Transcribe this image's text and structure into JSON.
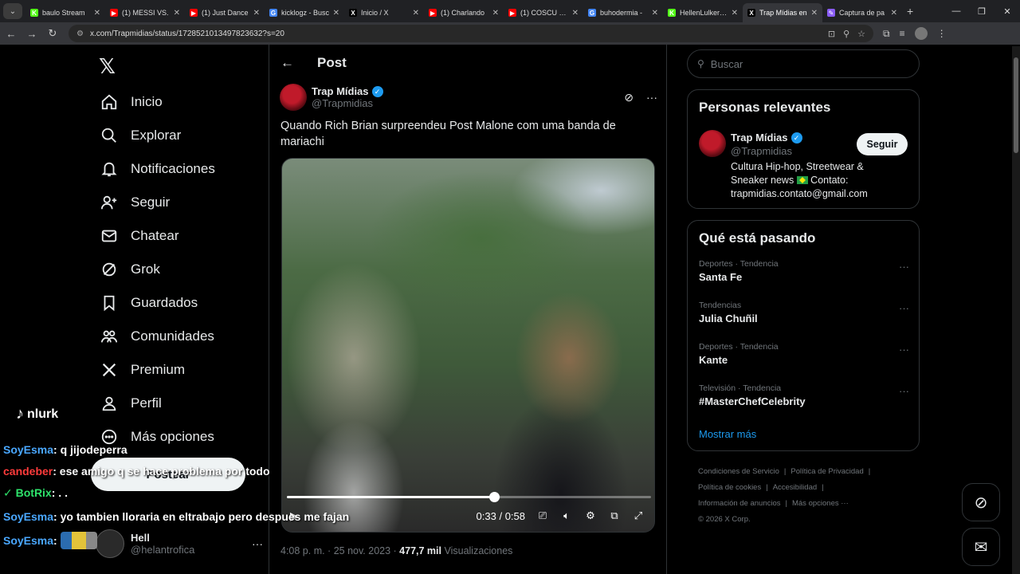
{
  "browser": {
    "tabs": [
      {
        "title": "baulo Stream",
        "color": "#53fc18",
        "glyph": "K"
      },
      {
        "title": "(1) MESSI VS.",
        "color": "#ff0000",
        "glyph": "▶"
      },
      {
        "title": "(1) Just Dance",
        "color": "#ff0000",
        "glyph": "▶"
      },
      {
        "title": "kicklogz - Busc",
        "color": "#4285f4",
        "glyph": "G"
      },
      {
        "title": "Inicio / X",
        "color": "#000000",
        "glyph": "X"
      },
      {
        "title": "(1) Charlando",
        "color": "#ff0000",
        "glyph": "▶"
      },
      {
        "title": "(1) COSCU DES",
        "color": "#ff0000",
        "glyph": "▶"
      },
      {
        "title": "buhodermia -",
        "color": "#4285f4",
        "glyph": "G"
      },
      {
        "title": "HellenLulker St",
        "color": "#53fc18",
        "glyph": "K"
      },
      {
        "title": "Trap Mídias en",
        "color": "#000000",
        "glyph": "X"
      },
      {
        "title": "Captura de pa",
        "color": "#8a5cf6",
        "glyph": "✎"
      }
    ],
    "active_tab_index": 9,
    "url": "x.com/Trapmidias/status/1728521013497823632?s=20"
  },
  "nav": {
    "items": [
      {
        "label": "Inicio",
        "icon": "home-icon"
      },
      {
        "label": "Explorar",
        "icon": "search-icon"
      },
      {
        "label": "Notificaciones",
        "icon": "bell-icon"
      },
      {
        "label": "Seguir",
        "icon": "add-person-icon"
      },
      {
        "label": "Chatear",
        "icon": "mail-icon"
      },
      {
        "label": "Grok",
        "icon": "grok-icon"
      },
      {
        "label": "Guardados",
        "icon": "bookmark-icon"
      },
      {
        "label": "Comunidades",
        "icon": "communities-icon"
      },
      {
        "label": "Premium",
        "icon": "x-icon"
      },
      {
        "label": "Perfil",
        "icon": "person-icon"
      },
      {
        "label": "Más opciones",
        "icon": "more-circle-icon"
      }
    ],
    "post_button": "Postear",
    "account": {
      "name": "Hell",
      "handle": "@helantrofica"
    }
  },
  "post": {
    "header_title": "Post",
    "author_name": "Trap Mídias",
    "author_handle": "@Trapmidias",
    "text": "Quando Rich Brian surpreendeu Post Malone com uma banda de mariachi",
    "video": {
      "current": "0:33",
      "total": "0:58",
      "progress": 0.569
    },
    "time": "4:08 p. m. · 25 nov. 2023 · ",
    "views_count": "477,7 mil",
    "views_label": " Visualizaciones"
  },
  "sidebar": {
    "search_placeholder": "Buscar",
    "relevant_title": "Personas relevantes",
    "relevant": {
      "name": "Trap Mídias",
      "handle": "@Trapmidias",
      "follow_label": "Seguir",
      "bio_1": "Cultura Hip-hop, Streetwear &",
      "bio_2": "Sneaker news",
      "bio_3": " Contato:",
      "bio_4": "trapmidias.contato@gmail.com"
    },
    "trending_title": "Qué está pasando",
    "trends": [
      {
        "context": "Deportes · Tendencia",
        "title": "Santa Fe"
      },
      {
        "context": "Tendencias",
        "title": "Julia Chuñil"
      },
      {
        "context": "Deportes · Tendencia",
        "title": "Kante"
      },
      {
        "context": "Televisión · Tendencia",
        "title": "#MasterChefCelebrity"
      }
    ],
    "show_more": "Mostrar más",
    "footer": {
      "l1a": "Condiciones de Servicio",
      "l1b": "Política de Privacidad",
      "l2a": "Política de cookies",
      "l2b": "Accesibilidad",
      "l3a": "Información de anuncios",
      "l3b": "Más opciones ···",
      "copyright": "© 2026 X Corp."
    }
  },
  "overlay": {
    "tiktok_name": "nlurk",
    "chat": [
      {
        "user": "SoyEsma",
        "text": ": q jijodeperra",
        "cls": "u1"
      },
      {
        "user": "candeber",
        "text": ": ese amigo q se hace problema por todo",
        "cls": "u2"
      },
      {
        "user": "BotRix",
        "text": ": . .",
        "cls": "u3"
      },
      {
        "user": "SoyEsma",
        "text": ": yo tambien lloraria en eltrabajo pero despues me fajan",
        "cls": "u1"
      },
      {
        "user": "SoyEsma",
        "text": ":",
        "cls": "u1"
      }
    ]
  }
}
